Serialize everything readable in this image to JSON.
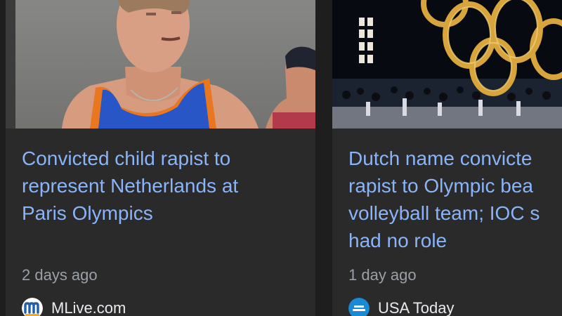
{
  "cards": [
    {
      "headline_lines": [
        "Convicted child rapist to",
        "represent Netherlands at",
        "Paris Olympics"
      ],
      "time": "2 days ago",
      "source": "MLive.com",
      "logo_icon": "mlive-logo-icon",
      "logo_colors": [
        "#ffffff",
        "#1d5fa8",
        "#f5a623"
      ]
    },
    {
      "headline_lines": [
        "Dutch name convicte",
        "rapist to Olympic bea",
        "volleyball team; IOC s",
        "had no role"
      ],
      "time": "1 day ago",
      "source": "USA Today",
      "logo_icon": "usa-today-logo-icon",
      "logo_colors": [
        "#1a8ad4",
        "#ffffff"
      ]
    }
  ],
  "colors": {
    "page_background": "#1e1e1e",
    "card_background": "#2a2a2b",
    "headline": "#8ab4f8",
    "time": "#9aa0a6",
    "source": "#e8eaed"
  }
}
